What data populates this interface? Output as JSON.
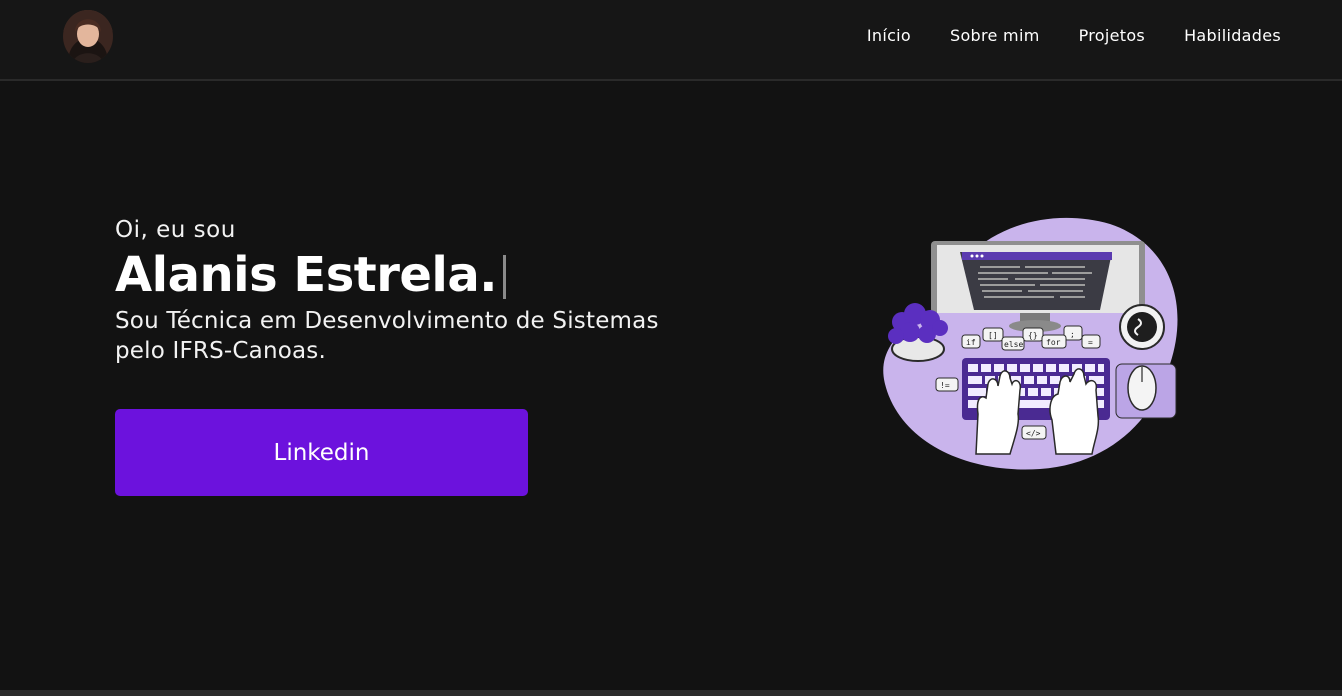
{
  "header": {
    "avatar_icon": "profile-photo",
    "nav": [
      {
        "label": "Início"
      },
      {
        "label": "Sobre mim"
      },
      {
        "label": "Projetos"
      },
      {
        "label": "Habilidades"
      }
    ]
  },
  "hero": {
    "greeting": "Oi, eu sou",
    "name": "Alanis Estrela.",
    "description_line1": "Sou Técnica em Desenvolvimento de Sistemas",
    "description_line2": "pelo IFRS-Canoas.",
    "button_label": "Linkedin"
  },
  "illustration": {
    "code_tags": [
      "[]",
      "{}",
      ";",
      "if",
      "else",
      "for",
      "=",
      "!=",
      "</>"
    ]
  },
  "colors": {
    "background": "#121212",
    "header_bg": "#161616",
    "accent": "#6c12dd",
    "illustration_purple": "#c9b4ec",
    "illustration_dark_purple": "#4a2a92"
  }
}
